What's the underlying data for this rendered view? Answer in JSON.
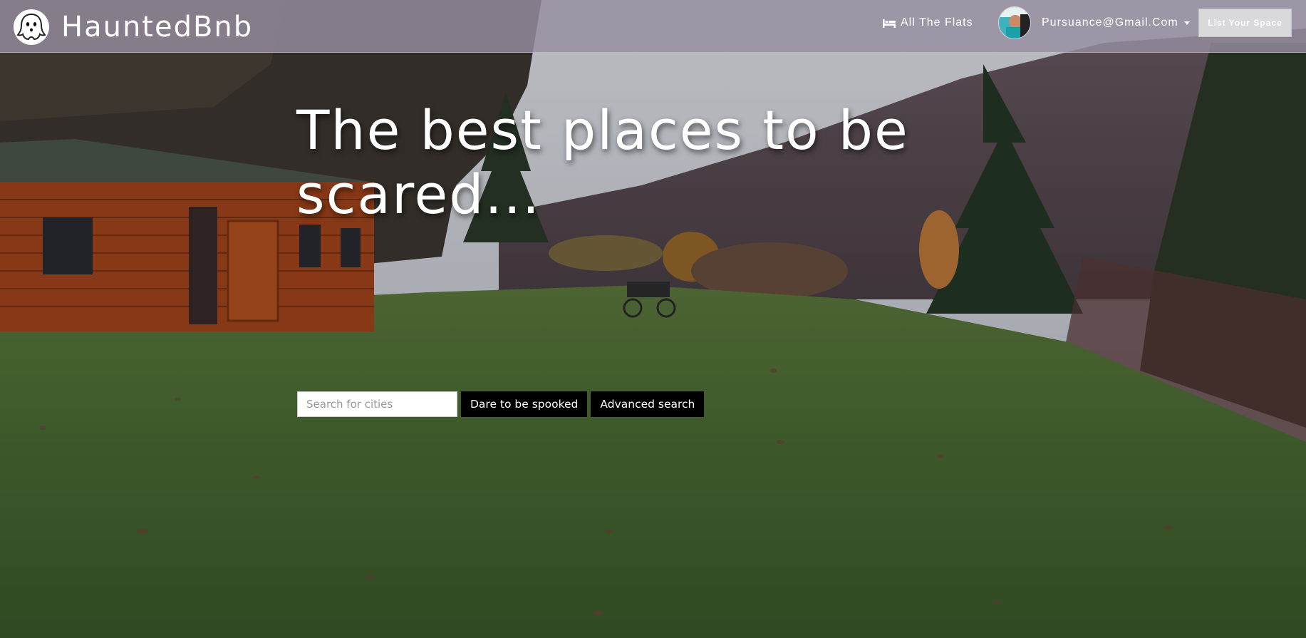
{
  "app": {
    "brand_name": "HauntedBnb",
    "logo_icon": "ghost-icon"
  },
  "nav": {
    "flats_link": {
      "label": "All The Flats",
      "icon": "bed-icon"
    },
    "user": {
      "email": "Pursuance@Gmail.Com",
      "avatar_icon": "avatar",
      "dropdown_icon": "caret-down-icon"
    },
    "list_space_label": "List Your Space"
  },
  "hero": {
    "title": "The best places to be scared...",
    "search": {
      "placeholder": "Search for cities",
      "value": "",
      "submit_label": "Dare to be spooked",
      "advanced_label": "Advanced search"
    }
  },
  "colors": {
    "navbar": "#968ea0",
    "button_dark": "#000000",
    "list_space_button": "#d9d8da"
  }
}
